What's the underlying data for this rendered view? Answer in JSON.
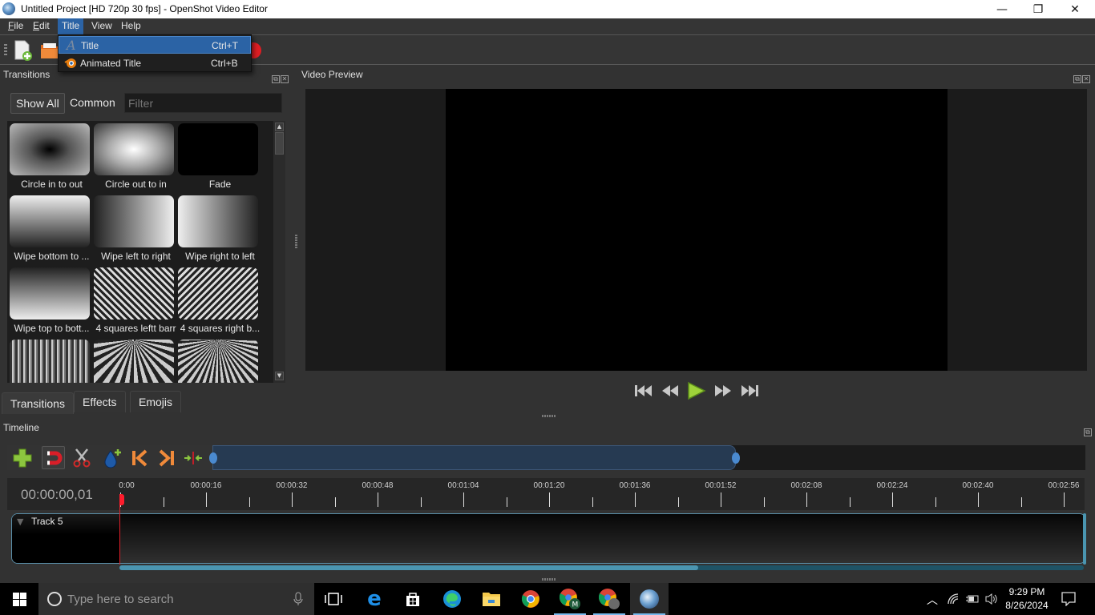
{
  "window": {
    "title": "Untitled Project [HD 720p 30 fps] - OpenShot Video Editor",
    "controls": {
      "minimize": "—",
      "restore": "❐",
      "close": "✕"
    }
  },
  "menubar": {
    "items": [
      {
        "label": "File",
        "mnemonic": "F"
      },
      {
        "label": "Edit",
        "mnemonic": "E"
      },
      {
        "label": "Title",
        "mnemonic": "",
        "active": true
      },
      {
        "label": "View",
        "mnemonic": ""
      },
      {
        "label": "Help",
        "mnemonic": ""
      }
    ]
  },
  "title_menu": {
    "items": [
      {
        "label": "Title",
        "shortcut": "Ctrl+T",
        "icon": "title-text-icon",
        "highlighted": true
      },
      {
        "label": "Animated Title",
        "shortcut": "Ctrl+B",
        "icon": "blender-icon",
        "highlighted": false
      }
    ]
  },
  "toolbar": {
    "icons": [
      "new-project-icon",
      "open-project-icon",
      "record-icon"
    ]
  },
  "transitions_panel": {
    "title": "Transitions",
    "filters": [
      {
        "label": "Show All",
        "selected": true
      },
      {
        "label": "Common",
        "selected": false
      }
    ],
    "filter_placeholder": "Filter",
    "items": [
      {
        "label": "Circle in to out",
        "thumb": "radial-dark-center"
      },
      {
        "label": "Circle out to in",
        "thumb": "radial-light-center"
      },
      {
        "label": "Fade",
        "thumb": "black"
      },
      {
        "label": "Wipe bottom to ...",
        "thumb": "vertical-light-top"
      },
      {
        "label": "Wipe left to right",
        "thumb": "horizontal-dark-left"
      },
      {
        "label": "Wipe right to left",
        "thumb": "horizontal-light-left"
      },
      {
        "label": "Wipe top to bott...",
        "thumb": "vertical-dark-top"
      },
      {
        "label": "4 squares leftt barr",
        "thumb": "diagonal-stripes-left"
      },
      {
        "label": "4 squares right b...",
        "thumb": "diagonal-stripes-right"
      },
      {
        "label": "",
        "thumb": "noise-vertical"
      },
      {
        "label": "",
        "thumb": "rays-1"
      },
      {
        "label": "",
        "thumb": "rays-2"
      }
    ]
  },
  "bottom_tabs": [
    {
      "label": "Transitions",
      "active": true
    },
    {
      "label": "Effects",
      "active": false
    },
    {
      "label": "Emojis",
      "active": false
    }
  ],
  "video_preview": {
    "title": "Video Preview",
    "controls": [
      "jump-start-icon",
      "rewind-icon",
      "play-icon",
      "fast-forward-icon",
      "jump-end-icon"
    ]
  },
  "timeline": {
    "title": "Timeline",
    "toolbar_icons": [
      "add-track-icon",
      "snap-magnet-icon",
      "razor-icon",
      "add-marker-icon",
      "previous-marker-icon",
      "next-marker-icon",
      "center-playhead-icon"
    ],
    "zoom_range_fraction": 0.6,
    "current_time": "00:00:00,01",
    "ruler_labels": [
      "0:00",
      "00:00:16",
      "00:00:32",
      "00:00:48",
      "00:01:04",
      "00:01:20",
      "00:01:36",
      "00:01:52",
      "00:02:08",
      "00:02:24",
      "00:02:40",
      "00:02:56"
    ],
    "tracks": [
      {
        "name": "Track 5"
      }
    ],
    "scroll_fraction": 0.6
  },
  "taskbar": {
    "search_placeholder": "Type here to search",
    "apps": [
      "task-view-icon",
      "edge-legacy-icon",
      "store-icon",
      "edge-icon",
      "file-explorer-icon",
      "chrome-icon",
      "chrome-profile-m-icon",
      "chrome-profile-2-icon",
      "openshot-icon"
    ],
    "time": "9:29 PM",
    "date": "8/26/2024"
  },
  "colors": {
    "accent": "#2b63a5",
    "panel_bg": "#323232",
    "playhead": "#e0202a",
    "track_border": "#5a8ea8"
  }
}
